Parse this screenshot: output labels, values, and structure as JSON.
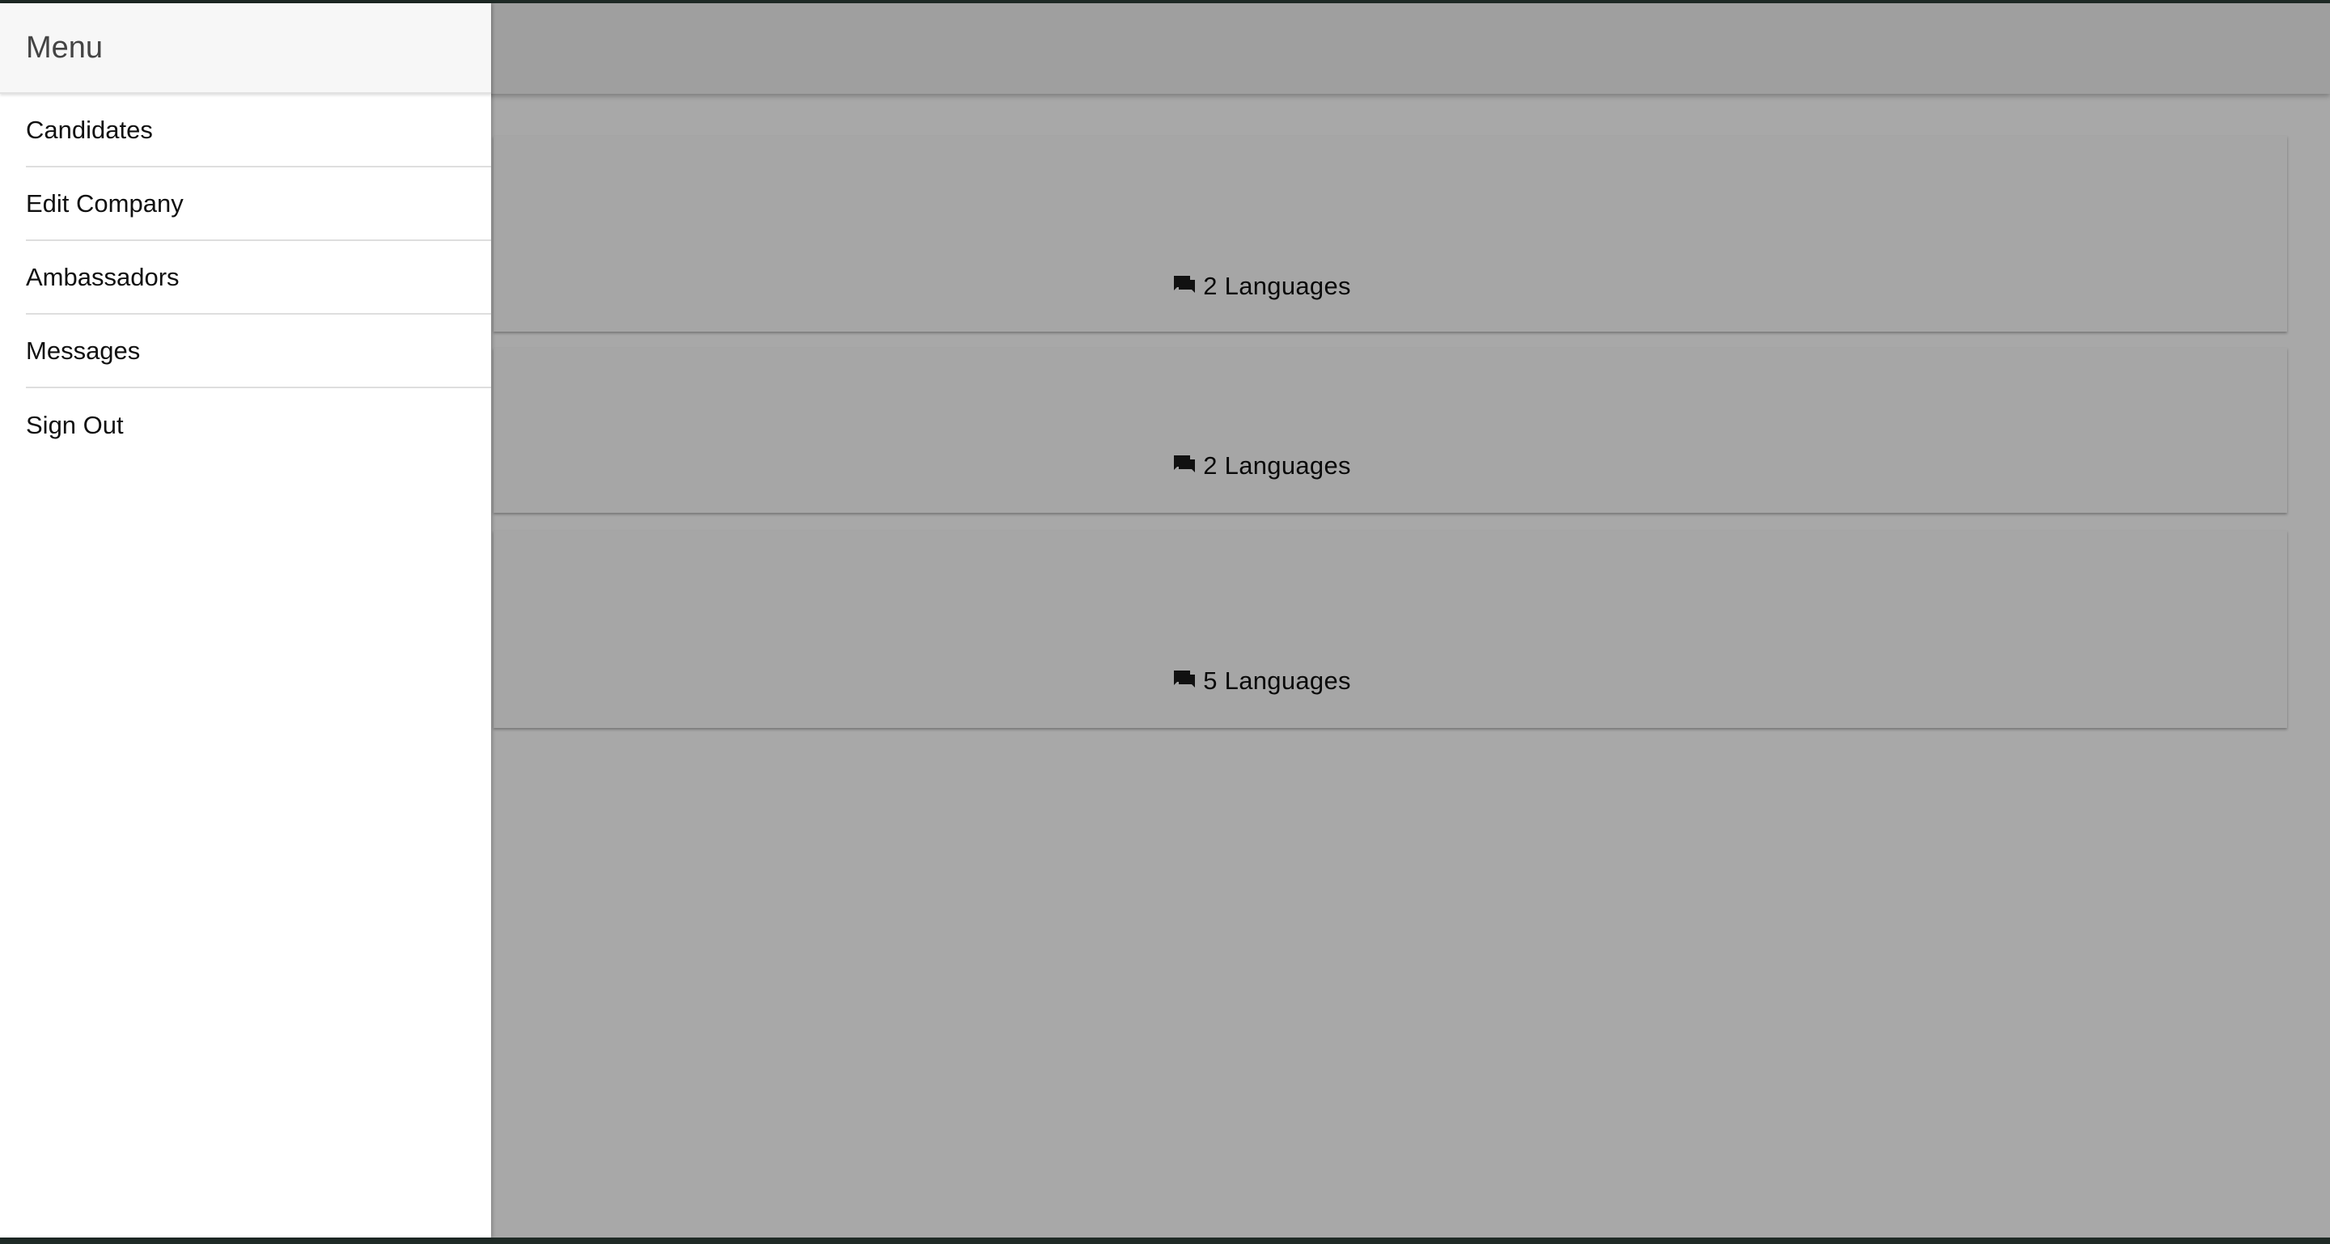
{
  "drawer": {
    "title": "Menu",
    "items": [
      {
        "label": "Candidates"
      },
      {
        "label": "Edit Company"
      },
      {
        "label": "Ambassadors"
      },
      {
        "label": "Messages"
      },
      {
        "label": "Sign Out"
      }
    ]
  },
  "cards": [
    {
      "languages_label": "2 Languages",
      "icon": "chat-bubbles-icon"
    },
    {
      "languages_label": "2 Languages",
      "icon": "chat-bubbles-icon"
    },
    {
      "languages_label": "5 Languages",
      "icon": "chat-bubbles-icon"
    }
  ],
  "colors": {
    "scrim": "#a8a8a8",
    "drawer_bg": "#ffffff",
    "drawer_header_bg": "#f7f7f7"
  }
}
